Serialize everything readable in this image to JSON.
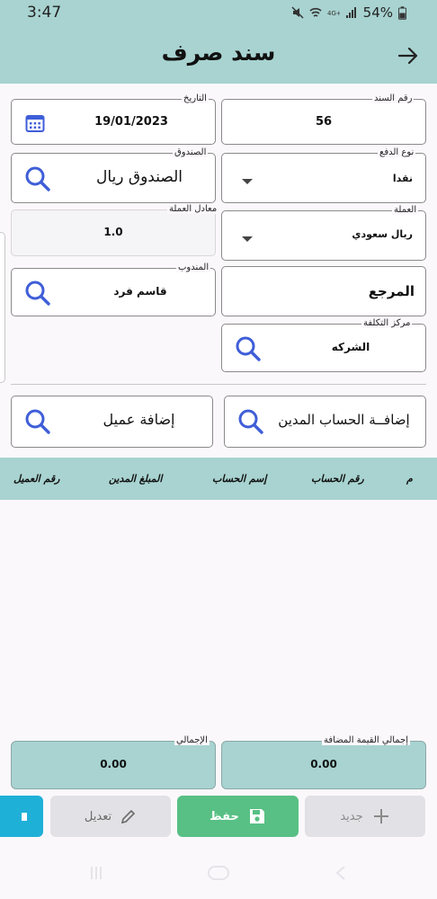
{
  "status_bar": {
    "time": "3:47",
    "battery": "54%"
  },
  "app_bar": {
    "title": "سند صرف"
  },
  "form": {
    "voucher_number": {
      "label": "رقم السند",
      "value": "56"
    },
    "date": {
      "label": "التاريخ",
      "value": "19/01/2023"
    },
    "payment_type": {
      "label": "نوع الدفع",
      "value": "نقدا"
    },
    "cash_box": {
      "label": "الصندوق",
      "value": "الصندوق ريال"
    },
    "currency": {
      "label": "العملة",
      "value": "ريال سعودي"
    },
    "exchange_rate": {
      "label": "معادل العملة",
      "value": "1.0"
    },
    "reference": {
      "value": "المرجع"
    },
    "representative": {
      "label": "المندوب",
      "value": "قاسم فرد"
    },
    "cost_center": {
      "label": "مركز التكلفة",
      "value": "الشركه"
    }
  },
  "actions": {
    "add_debit_account": "إضافــة الحساب المدين",
    "add_customer": "إضافة عميل"
  },
  "table": {
    "columns": [
      "م",
      "رقم الحساب",
      "إسم الحساب",
      "المبلغ المدين",
      "رقم العميل"
    ]
  },
  "totals": {
    "vat_total": {
      "label": "إجمالي القيمة المضافة",
      "value": "0.00"
    },
    "grand_total": {
      "label": "الإجمالي",
      "value": "0.00"
    }
  },
  "buttons": {
    "new": "جديد",
    "save": "حفظ",
    "edit": "تعديل"
  },
  "colors": {
    "header": "#a8d3d0",
    "save": "#58c084",
    "accent": "#1fb0d8",
    "search_icon": "#3f5ed8"
  }
}
